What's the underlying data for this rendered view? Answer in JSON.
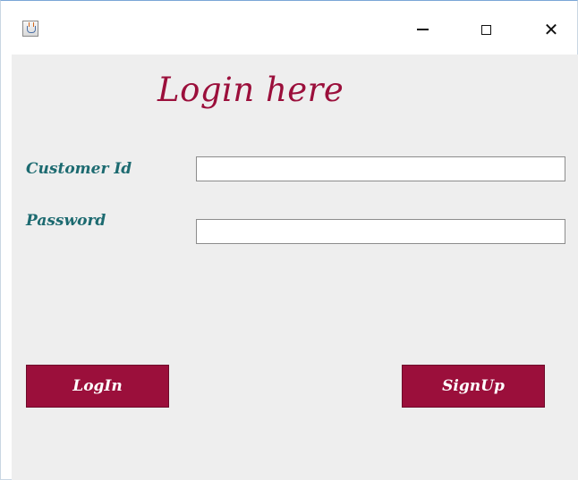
{
  "window": {
    "app_icon": "java-cup-icon",
    "controls": {
      "minimize_icon": "minimize-icon",
      "maximize_icon": "maximize-icon",
      "close_icon": "close-icon",
      "close_glyph": "✕"
    }
  },
  "form": {
    "heading": "Login here",
    "customer_id_label": "Customer Id",
    "customer_id_value": "",
    "password_label": "Password",
    "password_value": ""
  },
  "buttons": {
    "login_label": "LogIn",
    "signup_label": "SignUp"
  },
  "colors": {
    "accent": "#9b0f3b",
    "label": "#1c6a70",
    "panel": "#eeeeee"
  }
}
